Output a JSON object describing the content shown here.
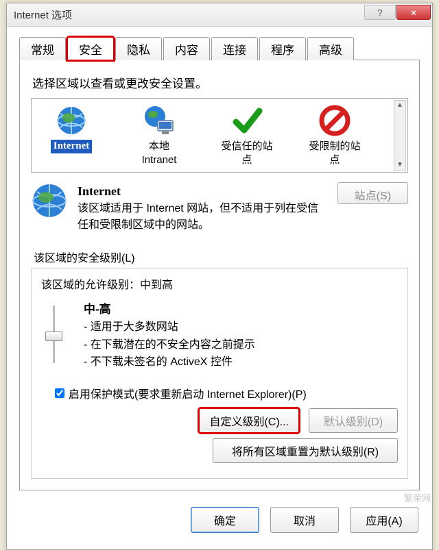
{
  "title": "Internet 选项",
  "titlebar": {
    "help": "?",
    "close": "×"
  },
  "tabs": [
    "常规",
    "安全",
    "隐私",
    "内容",
    "连接",
    "程序",
    "高级"
  ],
  "active_tab": 1,
  "section1_label": "选择区域以查看或更改安全设置。",
  "zones": [
    {
      "name": "Internet",
      "sub": ""
    },
    {
      "name": "本地",
      "sub": "Intranet"
    },
    {
      "name": "受信任的站",
      "sub": "点"
    },
    {
      "name": "受限制的站",
      "sub": "点"
    }
  ],
  "zone_detail": {
    "heading": "Internet",
    "desc": "该区域适用于 Internet 网站，但不适用于列在受信任和受限制区域中的网站。",
    "sites_btn": "站点(S)"
  },
  "level": {
    "label": "该区域的安全级别(L)",
    "allow": "该区域的允许级别：中到高",
    "current": "中-高",
    "bullets": [
      "- 适用于大多数网站",
      "- 在下载潜在的不安全内容之前提示",
      "- 不下载未签名的 ActiveX 控件"
    ]
  },
  "protected_mode": "启用保护模式(要求重新启动 Internet Explorer)(P)",
  "buttons": {
    "custom": "自定义级别(C)...",
    "default": "默认级别(D)",
    "reset": "将所有区域重置为默认级别(R)",
    "ok": "确定",
    "cancel": "取消",
    "apply": "应用(A)"
  },
  "watermark": "繁荣网"
}
